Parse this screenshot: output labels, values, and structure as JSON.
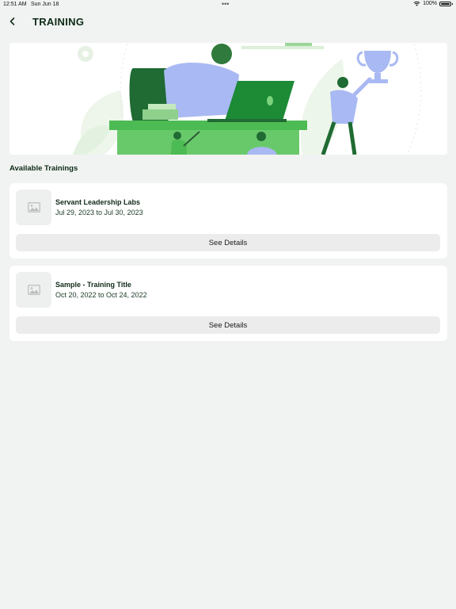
{
  "status": {
    "time": "12:51 AM",
    "date": "Sun Jun 18",
    "dots": "•••",
    "battery": "100%"
  },
  "header": {
    "title": "TRAINING"
  },
  "section": {
    "title": "Available Trainings"
  },
  "trainings": [
    {
      "title": "Servant Leadership Labs",
      "dates": "Jul 29, 2023 to Jul 30, 2023",
      "button": "See Details"
    },
    {
      "title": "Sample - Training Title",
      "dates": "Oct 20, 2022 to Oct 24, 2022",
      "button": "See Details"
    }
  ],
  "colors": {
    "accent_green": "#5cc15e",
    "dark_green": "#1f6b33",
    "light_blue": "#a9b9f3",
    "background": "#f0f3f1"
  },
  "icons": {
    "back": "chevron-left-icon",
    "thumbnail": "image-placeholder-icon",
    "wifi": "wifi-icon",
    "battery": "battery-icon"
  }
}
